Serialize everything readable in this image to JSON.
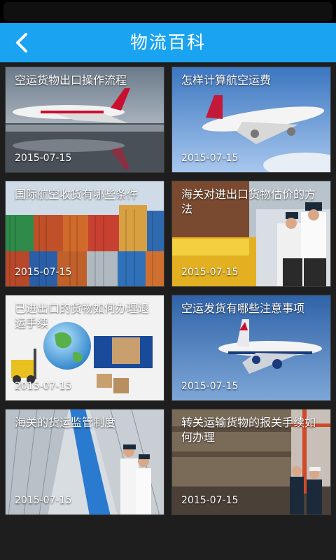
{
  "header": {
    "title": "物流百科",
    "back_icon": "chevron-left-icon"
  },
  "colors": {
    "header": "#1aa3f0",
    "background": "#1e1e1e"
  },
  "articles": [
    {
      "title": "空运货物出口操作流程",
      "date": "2015-07-15"
    },
    {
      "title": "怎样计算航空运费",
      "date": "2015-07-15"
    },
    {
      "title": "国际航空收货有哪些条件",
      "date": "2015-07-15"
    },
    {
      "title": "海关对进出口货物估价的方法",
      "date": "2015-07-15"
    },
    {
      "title": "已进出口的货物如何办理退运手续",
      "date": "2015-07-15"
    },
    {
      "title": "空运发货有哪些注意事项",
      "date": "2015-07-15"
    },
    {
      "title": "海关的货运监管制度",
      "date": "2015-07-15"
    },
    {
      "title": "转关运输货物的报关手续如何办理",
      "date": "2015-07-15"
    }
  ]
}
